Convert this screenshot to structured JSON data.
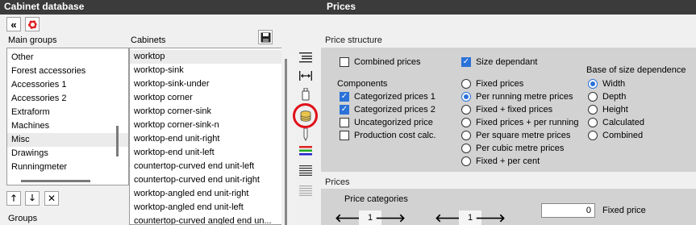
{
  "left_title": "Cabinet database",
  "right_title": "Prices",
  "main_groups": {
    "label": "Main groups",
    "items": [
      "Other",
      "Forest accessories",
      "Accessories 1",
      "Accessories 2",
      "Extraform",
      "Machines",
      "Misc",
      "Drawings",
      "Runningmeter"
    ],
    "selected": "Misc"
  },
  "cabinets": {
    "label": "Cabinets",
    "items": [
      "worktop",
      "worktop-sink",
      "worktop-sink-under",
      "worktop corner",
      "worktop corner-sink",
      "worktop corner-sink-n",
      "worktop-end unit-right",
      "worktop-end unit-left",
      "countertop-curved end unit-left",
      "countertop-curved end unit-right",
      "worktop-angled end unit-right",
      "worktop-angled end unit-left",
      "countertop-curved angled end un..."
    ],
    "selected": "worktop"
  },
  "groups_label": "Groups",
  "price_structure": {
    "title": "Price structure",
    "combined_prices": {
      "label": "Combined prices",
      "checked": false
    },
    "size_dependant": {
      "label": "Size dependant",
      "checked": true
    },
    "components_label": "Components",
    "components": [
      {
        "label": "Categorized prices 1",
        "checked": true
      },
      {
        "label": "Categorized prices 2",
        "checked": true
      },
      {
        "label": "Uncategorized price",
        "checked": false
      },
      {
        "label": "Production cost calc.",
        "checked": false
      }
    ],
    "price_types": [
      {
        "label": "Fixed prices",
        "selected": false
      },
      {
        "label": "Per running metre prices",
        "selected": true
      },
      {
        "label": "Fixed + fixed prices",
        "selected": false
      },
      {
        "label": "Fixed prices + per running",
        "selected": false
      },
      {
        "label": "Per square metre prices",
        "selected": false
      },
      {
        "label": "Per cubic metre prices",
        "selected": false
      },
      {
        "label": "Fixed + per cent",
        "selected": false
      }
    ],
    "base_label": "Base of size dependence",
    "base_options": [
      {
        "label": "Width",
        "selected": true
      },
      {
        "label": "Depth",
        "selected": false
      },
      {
        "label": "Height",
        "selected": false
      },
      {
        "label": "Calculated",
        "selected": false
      },
      {
        "label": "Combined",
        "selected": false
      }
    ]
  },
  "prices": {
    "title": "Prices",
    "categories_label": "Price categories",
    "stepper1_value": "1",
    "stepper2_value": "1",
    "fixed_price_value": "0",
    "fixed_price_label": "Fixed price"
  },
  "colors": {
    "accent": "#2b72d8",
    "title_bg": "#3b3b3b",
    "highlight_ring": "#e0101a"
  }
}
